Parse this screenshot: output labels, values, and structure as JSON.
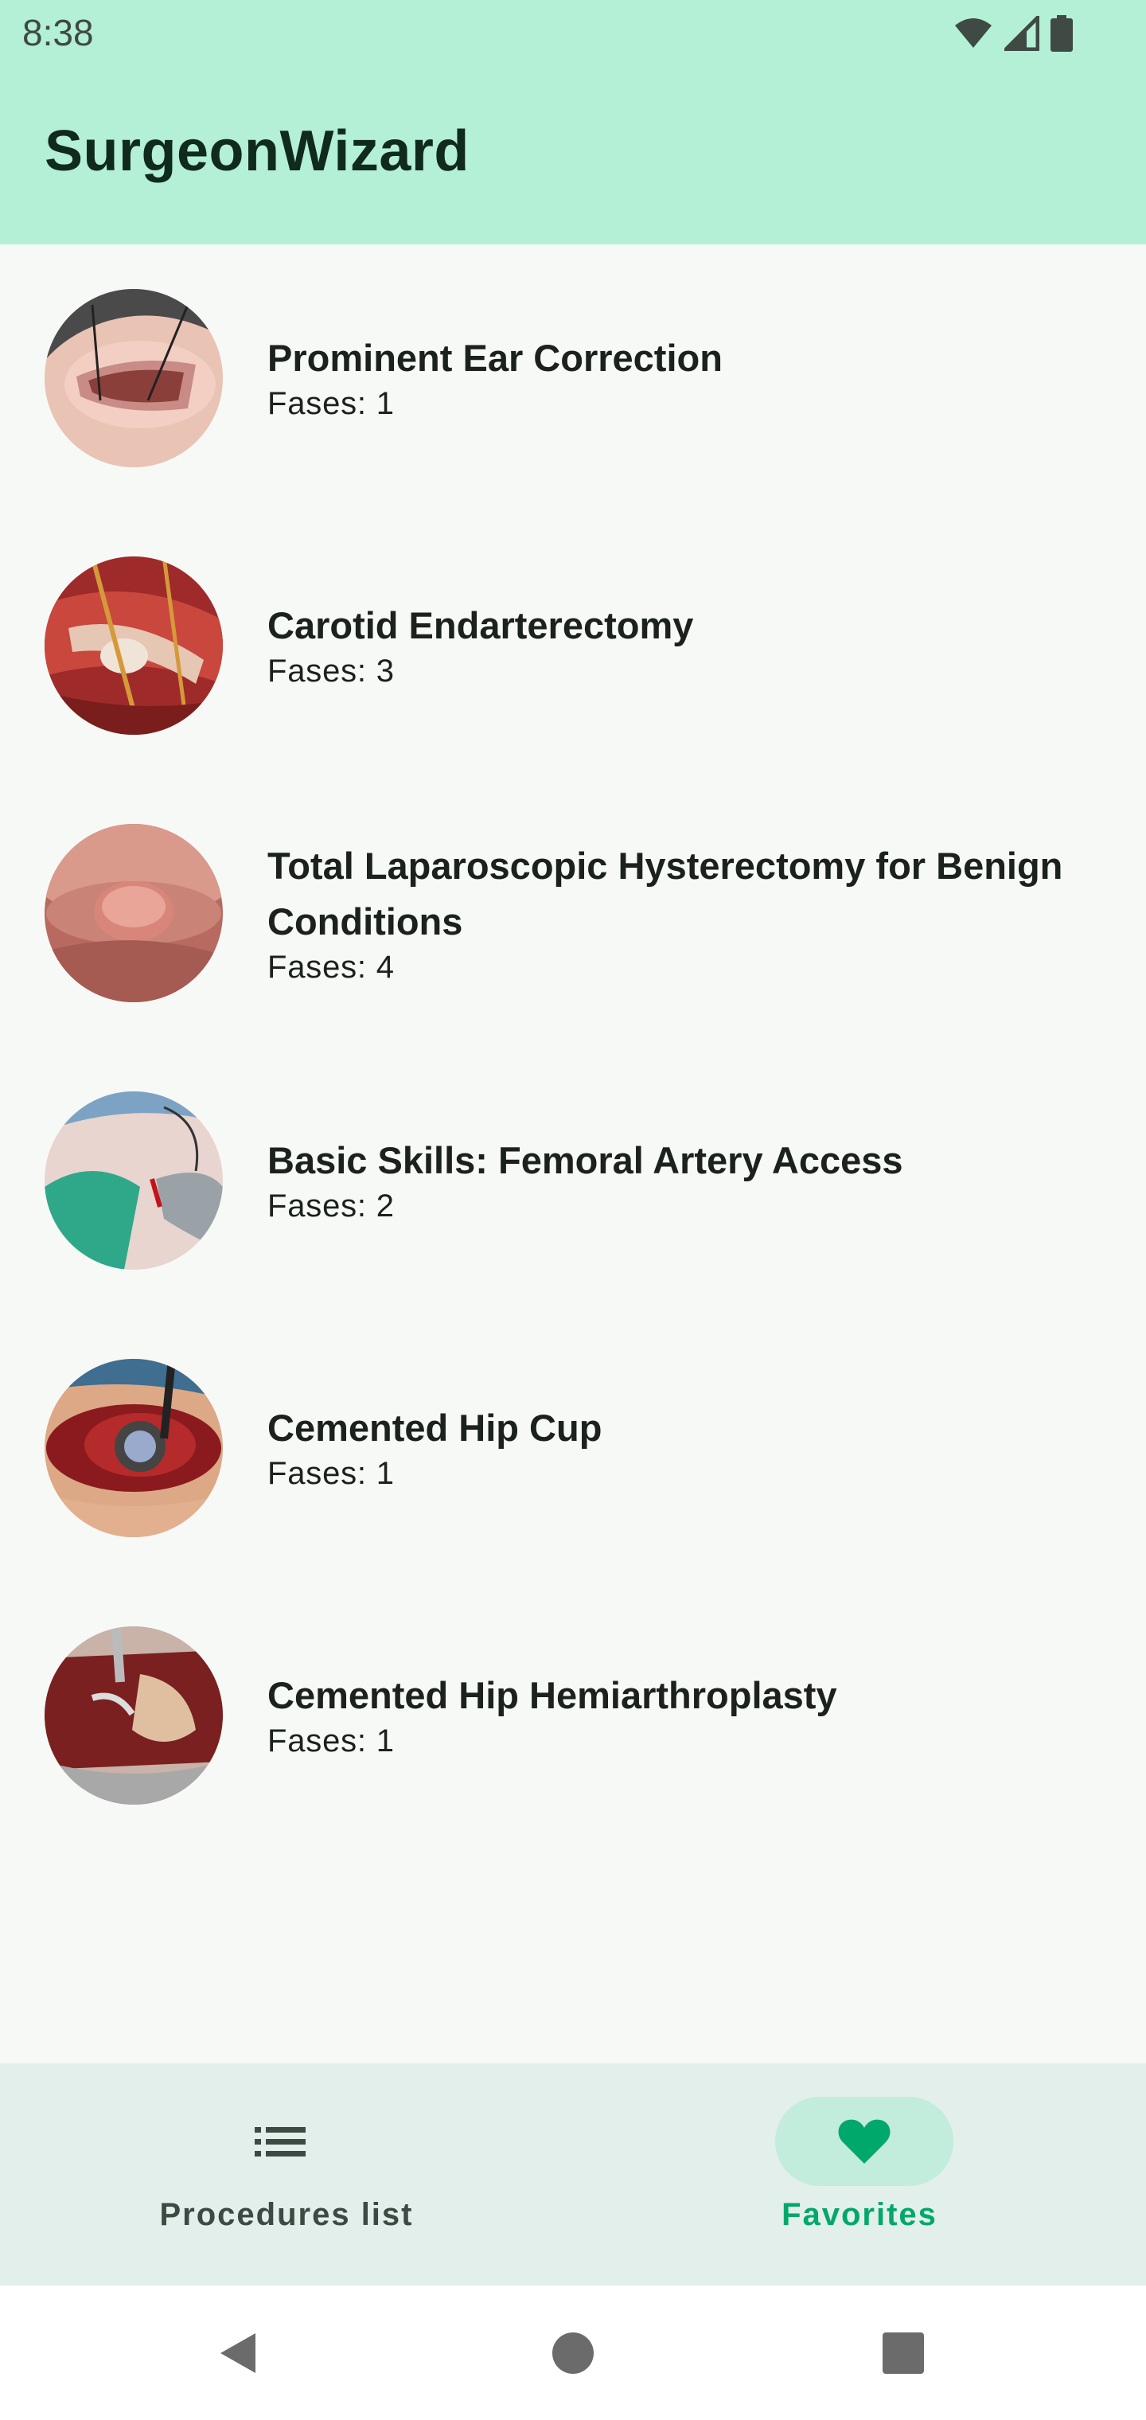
{
  "status_bar": {
    "time": "8:38",
    "icons": [
      "wifi-icon",
      "signal-icon",
      "battery-icon"
    ]
  },
  "app_bar": {
    "title": "SurgeonWizard"
  },
  "procedures": [
    {
      "title": "Prominent Ear Correction",
      "phases": "Fases: 1"
    },
    {
      "title": "Carotid Endarterectomy",
      "phases": "Fases: 3"
    },
    {
      "title": "Total Laparoscopic Hysterectomy for Benign Conditions",
      "phases": "Fases: 4"
    },
    {
      "title": "Basic Skills: Femoral Artery Access",
      "phases": "Fases: 2"
    },
    {
      "title": "Cemented Hip Cup",
      "phases": "Fases: 1"
    },
    {
      "title": "Cemented Hip Hemiarthroplasty",
      "phases": "Fases: 1"
    }
  ],
  "bottom_nav": {
    "items": [
      {
        "label": "Procedures list",
        "icon": "list-icon",
        "selected": false
      },
      {
        "label": "Favorites",
        "icon": "heart-icon",
        "selected": true
      }
    ]
  },
  "system_nav": {
    "buttons": [
      "back-icon",
      "home-icon",
      "recents-icon"
    ]
  },
  "colors": {
    "app_bar_bg": "#b3f0d6",
    "accent": "#00a86b",
    "nav_bg": "#e3efea",
    "nav_indicator": "#c2ecdb"
  }
}
